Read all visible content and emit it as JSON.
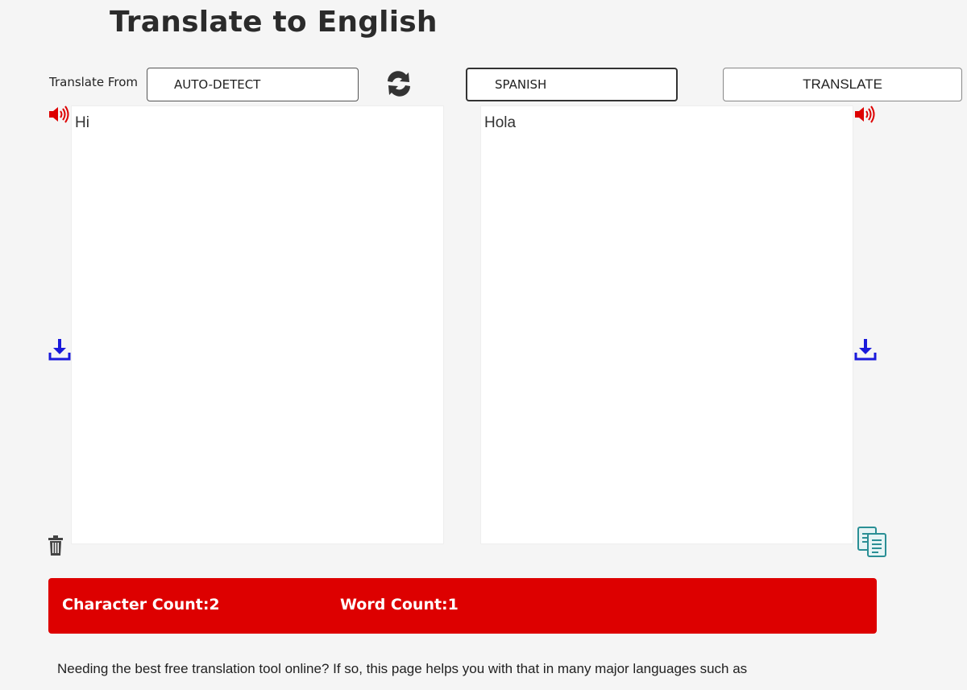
{
  "header": {
    "title": "Translate to English"
  },
  "controls": {
    "from_label": "Translate From",
    "source_language": "AUTO-DETECT",
    "target_language": "SPANISH",
    "translate_label": "TRANSLATE"
  },
  "panels": {
    "source_text": "Hi",
    "target_text": "Hola"
  },
  "counts": {
    "character_label": "Character Count:2",
    "word_label": "Word Count:1"
  },
  "footer": {
    "intro_text": "Needing the best free translation tool online? If so, this page helps you with that in many major languages such as"
  },
  "icons": {
    "speaker": "speaker-icon",
    "swap": "swap-icon",
    "download": "download-icon",
    "trash": "trash-icon",
    "copy": "copy-icon"
  },
  "colors": {
    "accent_red": "#dd0000",
    "download_blue": "#1a1adb",
    "copy_teal": "#2a8f95"
  }
}
